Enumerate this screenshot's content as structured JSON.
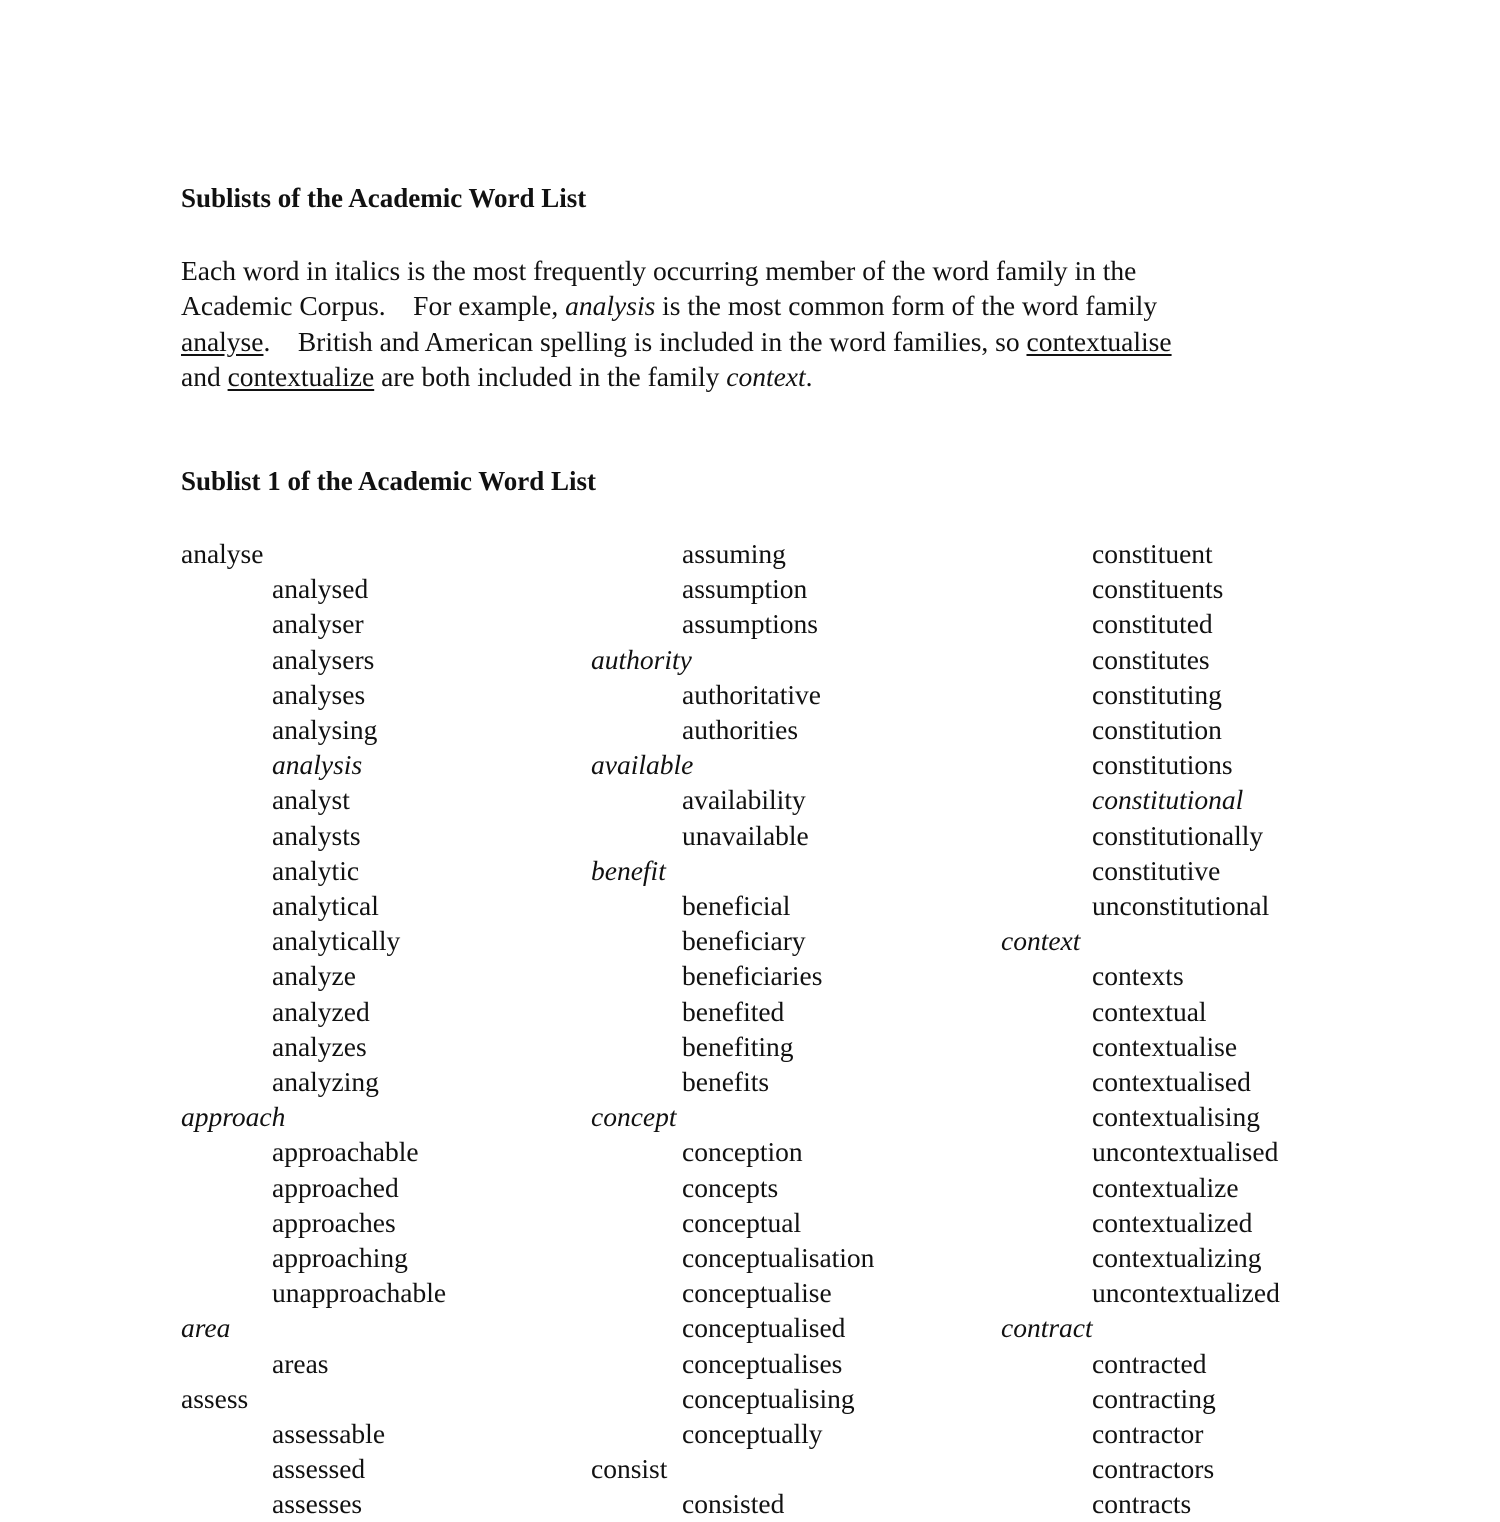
{
  "document": {
    "title": "Sublists of the Academic Word List",
    "intro": {
      "line1": "Each word in italics is the most frequently occurring member of the word family in the",
      "line2_a": "Academic Corpus.    For example, ",
      "line2_italic": "analysis",
      "line2_b": " is the most common form of the word family",
      "line3_underlined": "analyse",
      "line3_a": ".    British and American spelling is included in the word families, so ",
      "line3_underlined2": "contextualise",
      "line4_a": "and ",
      "line4_underlined": "contextualize",
      "line4_b": " are both included in the family ",
      "line4_italic": "context",
      "line4_end": "."
    },
    "sublist_heading": "Sublist 1 of the Academic Word List",
    "columns": [
      [
        {
          "w": "analyse",
          "head": true,
          "it": false
        },
        {
          "w": "analysed",
          "head": false,
          "it": false
        },
        {
          "w": "analyser",
          "head": false,
          "it": false
        },
        {
          "w": "analysers",
          "head": false,
          "it": false
        },
        {
          "w": "analyses",
          "head": false,
          "it": false
        },
        {
          "w": "analysing",
          "head": false,
          "it": false
        },
        {
          "w": "analysis",
          "head": false,
          "it": true
        },
        {
          "w": "analyst",
          "head": false,
          "it": false
        },
        {
          "w": "analysts",
          "head": false,
          "it": false
        },
        {
          "w": "analytic",
          "head": false,
          "it": false
        },
        {
          "w": "analytical",
          "head": false,
          "it": false
        },
        {
          "w": "analytically",
          "head": false,
          "it": false
        },
        {
          "w": "analyze",
          "head": false,
          "it": false
        },
        {
          "w": "analyzed",
          "head": false,
          "it": false
        },
        {
          "w": "analyzes",
          "head": false,
          "it": false
        },
        {
          "w": "analyzing",
          "head": false,
          "it": false
        },
        {
          "w": "approach",
          "head": true,
          "it": true
        },
        {
          "w": "approachable",
          "head": false,
          "it": false
        },
        {
          "w": "approached",
          "head": false,
          "it": false
        },
        {
          "w": "approaches",
          "head": false,
          "it": false
        },
        {
          "w": "approaching",
          "head": false,
          "it": false
        },
        {
          "w": "unapproachable",
          "head": false,
          "it": false
        },
        {
          "w": "area",
          "head": true,
          "it": true
        },
        {
          "w": "areas",
          "head": false,
          "it": false
        },
        {
          "w": "assess",
          "head": true,
          "it": false
        },
        {
          "w": "assessable",
          "head": false,
          "it": false
        },
        {
          "w": "assessed",
          "head": false,
          "it": false
        },
        {
          "w": "assesses",
          "head": false,
          "it": false
        }
      ],
      [
        {
          "w": "assuming",
          "head": false,
          "it": false
        },
        {
          "w": "assumption",
          "head": false,
          "it": false
        },
        {
          "w": "assumptions",
          "head": false,
          "it": false
        },
        {
          "w": "authority",
          "head": true,
          "it": true
        },
        {
          "w": "authoritative",
          "head": false,
          "it": false
        },
        {
          "w": "authorities",
          "head": false,
          "it": false
        },
        {
          "w": "available",
          "head": true,
          "it": true
        },
        {
          "w": "availability",
          "head": false,
          "it": false
        },
        {
          "w": "unavailable",
          "head": false,
          "it": false
        },
        {
          "w": "benefit",
          "head": true,
          "it": true
        },
        {
          "w": "beneficial",
          "head": false,
          "it": false
        },
        {
          "w": "beneficiary",
          "head": false,
          "it": false
        },
        {
          "w": "beneficiaries",
          "head": false,
          "it": false
        },
        {
          "w": "benefited",
          "head": false,
          "it": false
        },
        {
          "w": "benefiting",
          "head": false,
          "it": false
        },
        {
          "w": "benefits",
          "head": false,
          "it": false
        },
        {
          "w": "concept",
          "head": true,
          "it": true
        },
        {
          "w": "conception",
          "head": false,
          "it": false
        },
        {
          "w": "concepts",
          "head": false,
          "it": false
        },
        {
          "w": "conceptual",
          "head": false,
          "it": false
        },
        {
          "w": "conceptualisation",
          "head": false,
          "it": false
        },
        {
          "w": "conceptualise",
          "head": false,
          "it": false
        },
        {
          "w": "conceptualised",
          "head": false,
          "it": false
        },
        {
          "w": "conceptualises",
          "head": false,
          "it": false
        },
        {
          "w": "conceptualising",
          "head": false,
          "it": false
        },
        {
          "w": "conceptually",
          "head": false,
          "it": false
        },
        {
          "w": "consist",
          "head": true,
          "it": false
        },
        {
          "w": "consisted",
          "head": false,
          "it": false
        }
      ],
      [
        {
          "w": "constituent",
          "head": false,
          "it": false
        },
        {
          "w": "constituents",
          "head": false,
          "it": false
        },
        {
          "w": "constituted",
          "head": false,
          "it": false
        },
        {
          "w": "constitutes",
          "head": false,
          "it": false
        },
        {
          "w": "constituting",
          "head": false,
          "it": false
        },
        {
          "w": "constitution",
          "head": false,
          "it": false
        },
        {
          "w": "constitutions",
          "head": false,
          "it": false
        },
        {
          "w": "constitutional",
          "head": false,
          "it": true
        },
        {
          "w": "constitutionally",
          "head": false,
          "it": false
        },
        {
          "w": "constitutive",
          "head": false,
          "it": false
        },
        {
          "w": "unconstitutional",
          "head": false,
          "it": false
        },
        {
          "w": "context",
          "head": true,
          "it": true
        },
        {
          "w": "contexts",
          "head": false,
          "it": false
        },
        {
          "w": "contextual",
          "head": false,
          "it": false
        },
        {
          "w": "contextualise",
          "head": false,
          "it": false
        },
        {
          "w": "contextualised",
          "head": false,
          "it": false
        },
        {
          "w": "contextualising",
          "head": false,
          "it": false
        },
        {
          "w": "uncontextualised",
          "head": false,
          "it": false
        },
        {
          "w": "contextualize",
          "head": false,
          "it": false
        },
        {
          "w": "contextualized",
          "head": false,
          "it": false
        },
        {
          "w": "contextualizing",
          "head": false,
          "it": false
        },
        {
          "w": "uncontextualized",
          "head": false,
          "it": false
        },
        {
          "w": "contract",
          "head": true,
          "it": true
        },
        {
          "w": "contracted",
          "head": false,
          "it": false
        },
        {
          "w": "contracting",
          "head": false,
          "it": false
        },
        {
          "w": "contractor",
          "head": false,
          "it": false
        },
        {
          "w": "contractors",
          "head": false,
          "it": false
        },
        {
          "w": "contracts",
          "head": false,
          "it": false
        }
      ]
    ]
  }
}
